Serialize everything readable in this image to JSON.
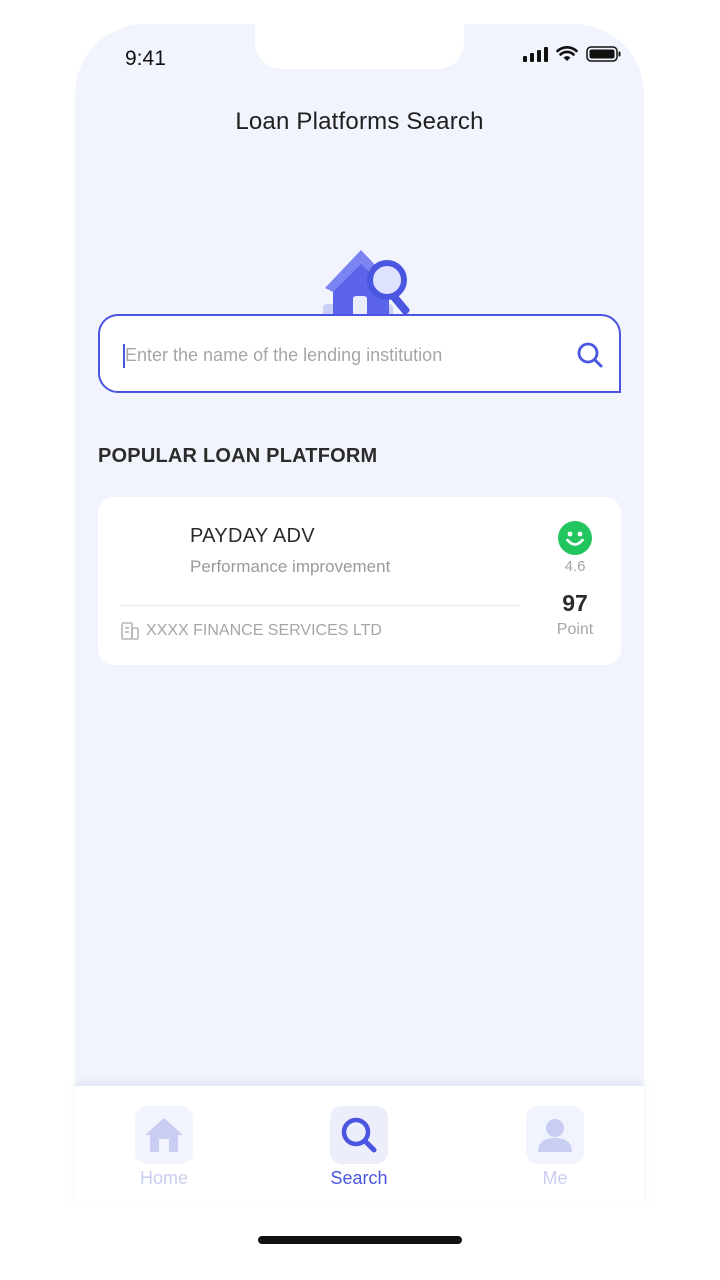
{
  "status_bar": {
    "time": "9:41"
  },
  "header": {
    "title": "Loan Platforms Search"
  },
  "search": {
    "placeholder": "Enter the name of the lending institution"
  },
  "section": {
    "title": "POPULAR LOAN PLATFORM"
  },
  "platforms": [
    {
      "name": "PAYDAY ADV",
      "description": "Performance improvement",
      "company": "XXXX FINANCE SERVICES LTD",
      "rating": "4.6",
      "points": "97",
      "points_label": "Point"
    }
  ],
  "tabbar": {
    "items": [
      {
        "label": "Home",
        "icon": "home-icon",
        "active": false
      },
      {
        "label": "Search",
        "icon": "search-icon",
        "active": true
      },
      {
        "label": "Me",
        "icon": "user-icon",
        "active": false
      }
    ]
  },
  "colors": {
    "accent": "#4a55e0",
    "background": "#f1f4fd",
    "rating_green": "#22c55e"
  }
}
